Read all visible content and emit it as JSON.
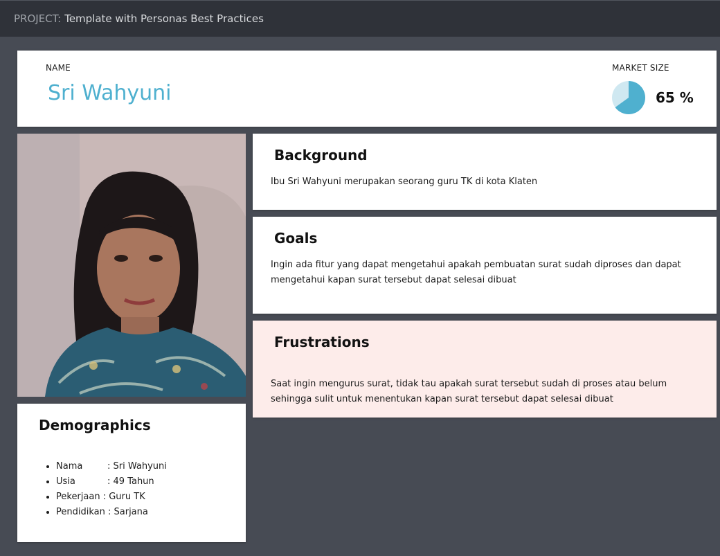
{
  "topbar": {
    "project_label": "PROJECT:",
    "project_name": "Template with Personas Best Practices"
  },
  "persona": {
    "name_label": "NAME",
    "name": "Sri Wahyuni",
    "market_label": "MARKET SIZE",
    "market_value": "65 %",
    "market_fraction": 0.65,
    "colors": {
      "accent": "#4fb0cf",
      "pie_track": "#cfe8f1"
    }
  },
  "photo": {
    "semantic": "persona-photo"
  },
  "background": {
    "title": "Background",
    "text": "Ibu Sri Wahyuni merupakan seorang guru TK di kota Klaten"
  },
  "goals": {
    "title": "Goals",
    "text": "Ingin ada fitur yang dapat mengetahui apakah pembuatan surat sudah diproses dan dapat mengetahui kapan surat tersebut dapat selesai dibuat"
  },
  "frustrations": {
    "title": "Frustrations",
    "text": "Saat ingin mengurus surat, tidak tau apakah surat tersebut sudah di proses atau belum sehingga sulit untuk menentukan kapan surat tersebut dapat selesai dibuat"
  },
  "demographics": {
    "title": "Demographics",
    "items": [
      {
        "key": "Nama",
        "value": ": Sri Wahyuni"
      },
      {
        "key": "Usia",
        "value": ": 49 Tahun"
      },
      {
        "key": "Pekerjaan",
        "value": ": Guru TK"
      },
      {
        "key": "Pendidikan",
        "value": ": Sarjana"
      }
    ]
  }
}
